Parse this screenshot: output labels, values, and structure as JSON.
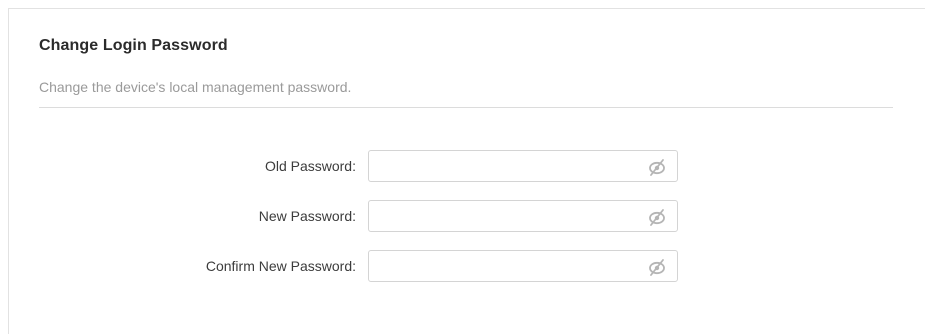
{
  "section": {
    "title": "Change Login Password",
    "description": "Change the device's local management password."
  },
  "fields": [
    {
      "label": "Old Password:",
      "value": "",
      "placeholder": "",
      "icon": "hidden-eye-icon"
    },
    {
      "label": "New Password:",
      "value": "",
      "placeholder": "",
      "icon": "hidden-eye-icon"
    },
    {
      "label": "Confirm New Password:",
      "value": "",
      "placeholder": "",
      "icon": "hidden-eye-icon"
    }
  ],
  "colors": {
    "title": "#2b2b2b",
    "description": "#9a9a9a",
    "icon": "#b5b5b5",
    "border": "#d4d4d4"
  }
}
